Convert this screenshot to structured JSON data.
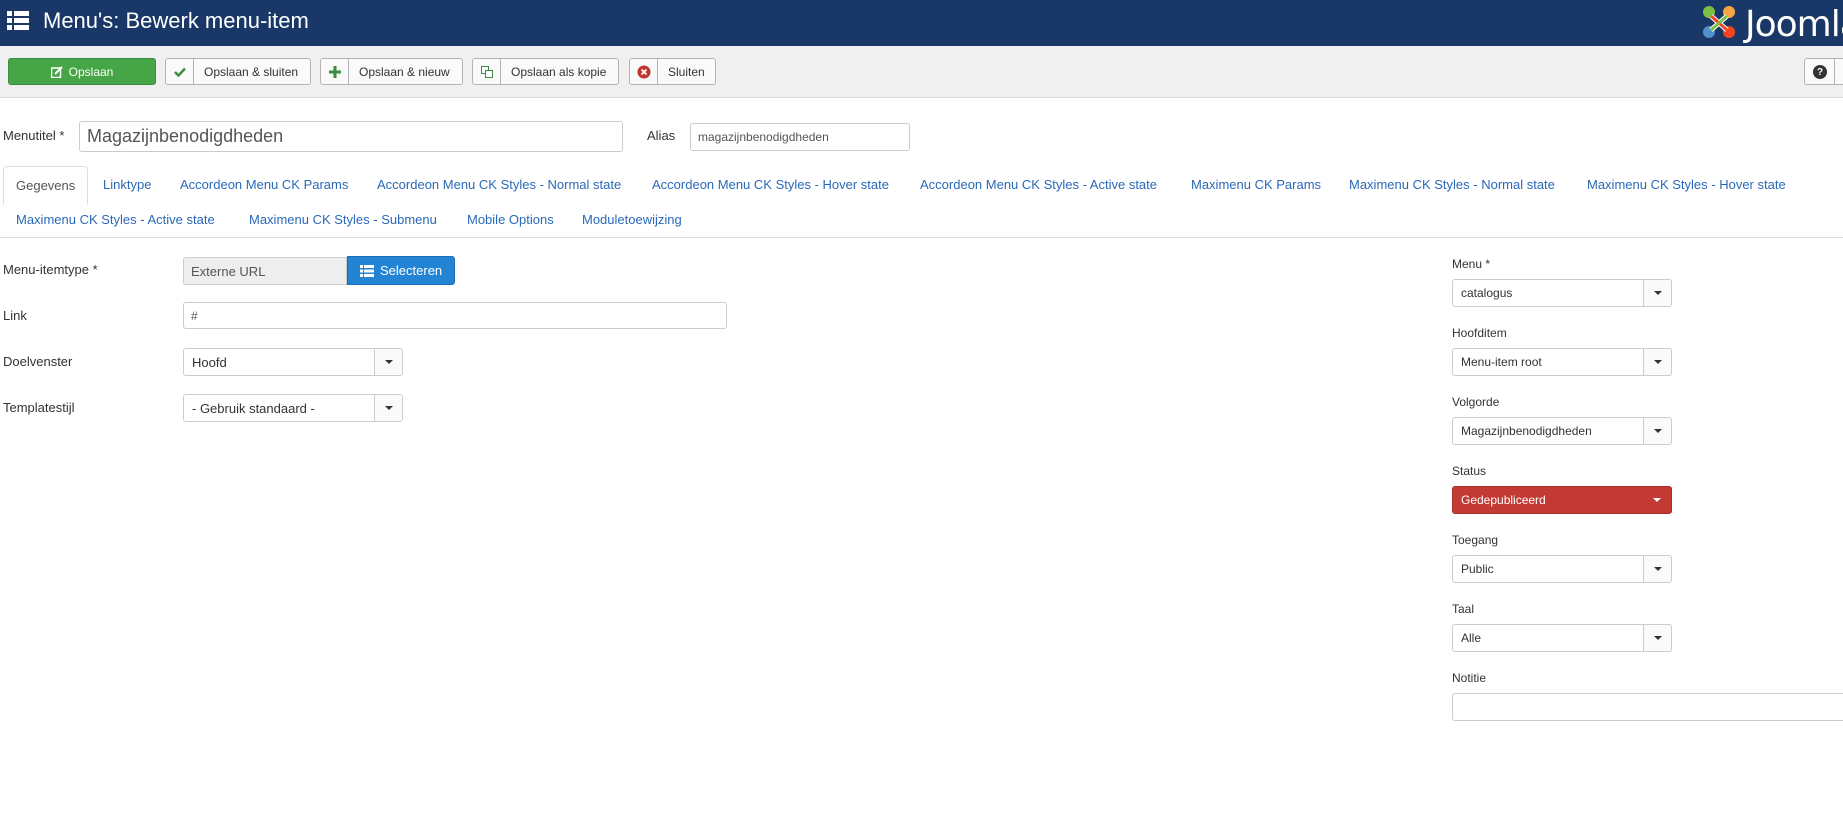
{
  "header": {
    "title": "Menu's: Bewerk menu-item",
    "logo_text": "Joomla"
  },
  "toolbar": {
    "save": "Opslaan",
    "save_close": "Opslaan & sluiten",
    "save_new": "Opslaan & nieuw",
    "save_copy": "Opslaan als kopie",
    "close": "Sluiten"
  },
  "title_row": {
    "menutitle_label": "Menutitel *",
    "menutitle_value": "Magazijnbenodigdheden",
    "alias_label": "Alias",
    "alias_value": "magazijnbenodigdheden"
  },
  "tabs": [
    "Gegevens",
    "Linktype",
    "Accordeon Menu CK Params",
    "Accordeon Menu CK Styles - Normal state",
    "Accordeon Menu CK Styles - Hover state",
    "Accordeon Menu CK Styles - Active state",
    "Maximenu CK Params",
    "Maximenu CK Styles - Normal state",
    "Maximenu CK Styles - Hover state",
    "Maximenu CK Styles - Active state",
    "Maximenu CK Styles - Submenu",
    "Mobile Options",
    "Moduletoewijzing"
  ],
  "form": {
    "itemtype_label": "Menu-itemtype *",
    "itemtype_value": "Externe URL",
    "select_button": "Selecteren",
    "link_label": "Link",
    "link_value": "#",
    "target_label": "Doelvenster",
    "target_value": "Hoofd",
    "template_label": "Templatestijl",
    "template_value": "- Gebruik standaard -"
  },
  "sidebar": {
    "menu_label": "Menu *",
    "menu_value": "catalogus",
    "parent_label": "Hoofditem",
    "parent_value": "Menu-item root",
    "order_label": "Volgorde",
    "order_value": "Magazijnbenodigdheden",
    "status_label": "Status",
    "status_value": "Gedepubliceerd",
    "access_label": "Toegang",
    "access_value": "Public",
    "language_label": "Taal",
    "language_value": "Alle",
    "note_label": "Notitie",
    "note_value": ""
  },
  "colors": {
    "header_bg": "#1a3867",
    "save_green": "#46a546",
    "select_blue": "#2384d3",
    "status_red": "#c23a33",
    "link_blue": "#2a69b8"
  },
  "icons": {
    "menu": "grid-menu-icon",
    "save": "edit-icon",
    "save_close": "check-icon",
    "save_new": "plus-icon",
    "save_copy": "copy-icon",
    "close": "close-circle-icon",
    "help": "question-icon",
    "select": "list-icon"
  }
}
